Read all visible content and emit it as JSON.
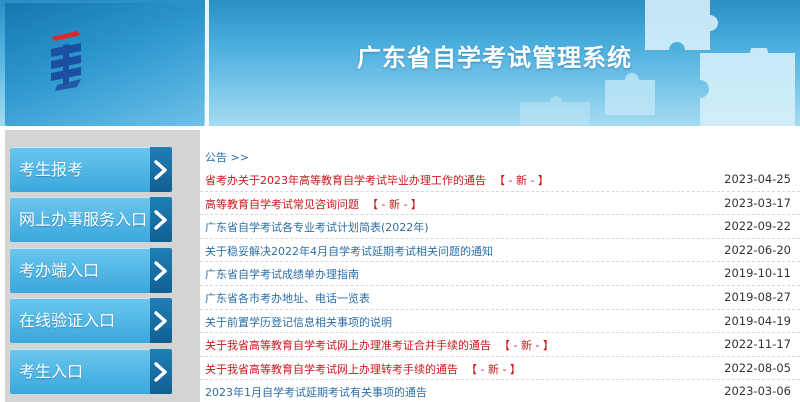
{
  "header": {
    "site_title": "广东省自学考试管理系统"
  },
  "sidebar": {
    "items": [
      {
        "label": "考生报考"
      },
      {
        "label": "网上办事服务入口"
      },
      {
        "label": "考办端入口"
      },
      {
        "label": "在线验证入口"
      },
      {
        "label": "考生入口"
      }
    ]
  },
  "main": {
    "crumb": "公告 >>",
    "new_tag": "【 - 新 - 】",
    "notices": [
      {
        "title": "省考办关于2023年高等教育自学考试毕业办理工作的通告",
        "date": "2023-04-25",
        "style": "red",
        "is_new": true
      },
      {
        "title": "高等教育自学考试常见咨询问题",
        "date": "2023-03-17",
        "style": "red",
        "is_new": true
      },
      {
        "title": "广东省自学考试各专业考试计划简表(2022年)",
        "date": "2022-09-22",
        "style": "blue",
        "is_new": false
      },
      {
        "title": "关于稳妥解决2022年4月自学考试延期考试相关问题的通知",
        "date": "2022-06-20",
        "style": "blue",
        "is_new": false
      },
      {
        "title": "广东省自学考试成绩单办理指南",
        "date": "2019-10-11",
        "style": "blue",
        "is_new": false
      },
      {
        "title": "广东省各市考办地址、电话一览表",
        "date": "2019-08-27",
        "style": "blue",
        "is_new": false
      },
      {
        "title": "关于前置学历登记信息相关事项的说明",
        "date": "2019-04-19",
        "style": "blue",
        "is_new": false
      },
      {
        "title": "关于我省高等教育自学考试网上办理准考证合并手续的通告",
        "date": "2022-11-17",
        "style": "red",
        "is_new": true
      },
      {
        "title": "关于我省高等教育自学考试网上办理转考手续的通告",
        "date": "2022-08-05",
        "style": "red",
        "is_new": true
      },
      {
        "title": "2023年1月自学考试延期考试有关事项的通告",
        "date": "2023-03-06",
        "style": "blue",
        "is_new": false
      }
    ]
  },
  "colors": {
    "accent_blue": "#2c6fa8",
    "new_red": "#c8191b",
    "button_blue": "#3aa7dc"
  }
}
